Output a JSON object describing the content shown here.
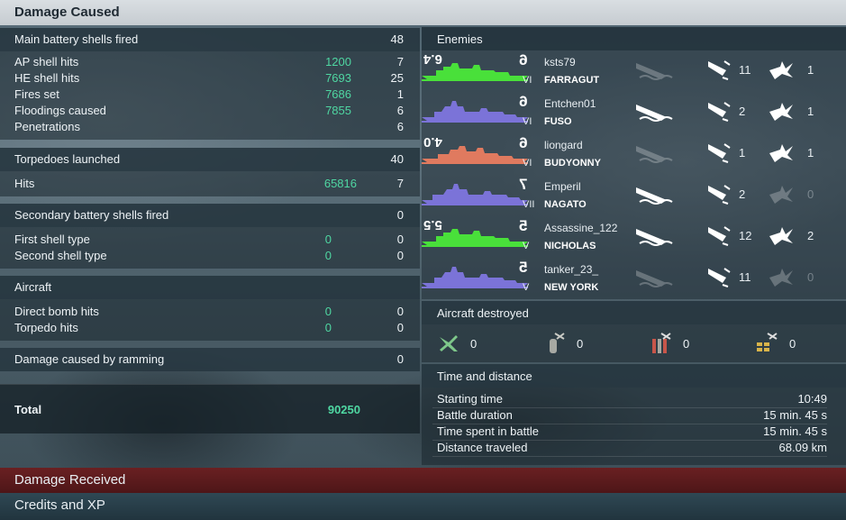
{
  "header": {
    "title": "Damage Caused"
  },
  "left": {
    "main_battery": {
      "label": "Main battery shells fired",
      "value": "48",
      "rows": [
        {
          "label": "AP shell hits",
          "dmg": "1200",
          "count": "7"
        },
        {
          "label": "HE shell hits",
          "dmg": "7693",
          "count": "25"
        },
        {
          "label": "Fires set",
          "dmg": "7686",
          "count": "1"
        },
        {
          "label": "Floodings caused",
          "dmg": "7855",
          "count": "6"
        },
        {
          "label": "Penetrations",
          "dmg": "",
          "count": "6"
        }
      ]
    },
    "torpedoes": {
      "label": "Torpedoes launched",
      "value": "40",
      "rows": [
        {
          "label": "Hits",
          "dmg": "65816",
          "count": "7"
        }
      ]
    },
    "secondary": {
      "label": "Secondary battery shells fired",
      "value": "0",
      "rows": [
        {
          "label": "First shell type",
          "dmg": "0",
          "count": "0"
        },
        {
          "label": "Second shell type",
          "dmg": "0",
          "count": "0"
        }
      ]
    },
    "aircraft": {
      "label": "Aircraft",
      "rows": [
        {
          "label": "Direct bomb hits",
          "dmg": "0",
          "count": "0"
        },
        {
          "label": "Torpedo hits",
          "dmg": "0",
          "count": "0"
        }
      ]
    },
    "ramming": {
      "label": "Damage caused by ramming",
      "value": "0"
    },
    "total": {
      "label": "Total",
      "value": "90250"
    }
  },
  "enemies": {
    "title": "Enemies",
    "ships": [
      {
        "player": "ksts79",
        "ship": "FARRAGUT",
        "tier": "VI",
        "hp": "6.4",
        "badge": "6",
        "color": "#49e03a",
        "sunk": false,
        "torp": "11",
        "hits": "1",
        "hits_active": true
      },
      {
        "player": "Entchen01",
        "ship": "FUSO",
        "tier": "VI",
        "hp": "",
        "badge": "6",
        "color": "#7b73d8",
        "sunk": true,
        "torp": "2",
        "hits": "1",
        "hits_active": true
      },
      {
        "player": "liongard",
        "ship": "BUDYONNY",
        "tier": "VI",
        "hp": "4.0",
        "badge": "6",
        "color": "#e07a5f",
        "sunk": false,
        "torp": "1",
        "hits": "1",
        "hits_active": true
      },
      {
        "player": "Emperil",
        "ship": "NAGATO",
        "tier": "VII",
        "hp": "",
        "badge": "7",
        "color": "#7b73d8",
        "sunk": true,
        "torp": "2",
        "hits": "0",
        "hits_active": false
      },
      {
        "player": "Assassine_122",
        "ship": "NICHOLAS",
        "tier": "V",
        "hp": "5.5",
        "badge": "5",
        "color": "#49e03a",
        "sunk": true,
        "torp": "12",
        "hits": "2",
        "hits_active": true
      },
      {
        "player": "tanker_23_",
        "ship": "NEW YORK",
        "tier": "V",
        "hp": "",
        "badge": "5",
        "color": "#7b73d8",
        "sunk": false,
        "torp": "11",
        "hits": "0",
        "hits_active": false
      }
    ]
  },
  "aircraft_destroyed": {
    "title": "Aircraft destroyed",
    "items": [
      {
        "icon": "fighter-plane-icon",
        "value": "0"
      },
      {
        "icon": "bomb-icon",
        "value": "0"
      },
      {
        "icon": "torpedo-bomber-icon",
        "value": "0"
      },
      {
        "icon": "dive-bomber-icon",
        "value": "0"
      }
    ]
  },
  "time_distance": {
    "title": "Time and distance",
    "rows": [
      {
        "label": "Starting time",
        "value": "10:49"
      },
      {
        "label": "Battle duration",
        "value": "15 min. 45 s"
      },
      {
        "label": "Time spent in battle",
        "value": "15 min. 45 s"
      },
      {
        "label": "Distance traveled",
        "value": "68.09 km"
      }
    ]
  },
  "bottom_tabs": [
    {
      "label": "Damage Received",
      "color": "#5a1a1c"
    },
    {
      "label": "Credits and XP",
      "color": "#28404c"
    }
  ]
}
